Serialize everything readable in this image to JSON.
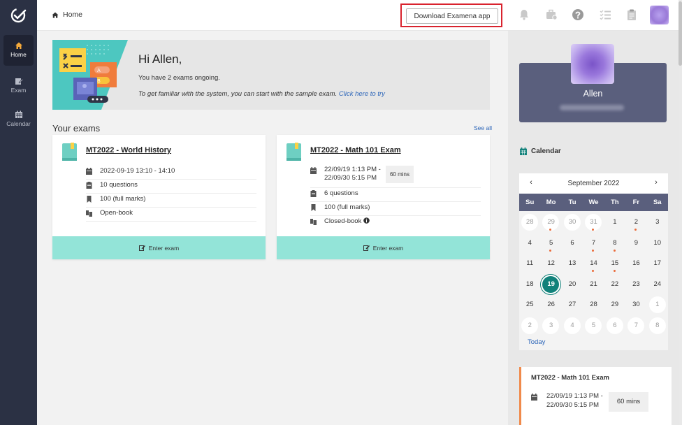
{
  "sidebar": {
    "items": [
      {
        "label": "Home",
        "icon": "home-icon",
        "active": true
      },
      {
        "label": "Exam",
        "icon": "exam-icon",
        "active": false
      },
      {
        "label": "Calendar",
        "icon": "calendar-icon",
        "active": false
      }
    ]
  },
  "header": {
    "breadcrumb": "Home",
    "download_label": "Download Examena app",
    "icons": [
      "bell-icon",
      "briefcase-icon",
      "help-icon",
      "checklist-icon",
      "clipboard-icon"
    ]
  },
  "welcome": {
    "greeting": "Hi Allen,",
    "ongoing": "You have 2 exams ongoing.",
    "familiar_text": "To get familiar with the system, you can start with the sample exam.",
    "familiar_link": "Click here to try"
  },
  "exams_section": {
    "title": "Your exams",
    "see_all": "See all"
  },
  "exams": [
    {
      "title": "MT2022 - World History",
      "datetime": "2022-09-19 13:10 - 14:10",
      "questions": "10 questions",
      "marks": "100 (full marks)",
      "mode": "Open-book",
      "enter_label": "Enter exam"
    },
    {
      "title": "MT2022 - Math 101 Exam",
      "datetime_line1": "22/09/19 1:13 PM -",
      "datetime_line2": "22/09/30 5:15 PM",
      "duration": "60 mins",
      "questions": "6 questions",
      "marks": "100 (full marks)",
      "mode": "Closed-book",
      "enter_label": "Enter exam"
    }
  ],
  "profile": {
    "name": "Allen"
  },
  "calendar": {
    "heading": "Calendar",
    "month": "September 2022",
    "prev": "‹",
    "next": "›",
    "weekdays": [
      "Su",
      "Mo",
      "Tu",
      "We",
      "Th",
      "Fr",
      "Sa"
    ],
    "today_label": "Today",
    "days": [
      {
        "n": "28",
        "other": true
      },
      {
        "n": "29",
        "other": true,
        "dot": true
      },
      {
        "n": "30",
        "other": true
      },
      {
        "n": "31",
        "other": true,
        "dot": true
      },
      {
        "n": "1"
      },
      {
        "n": "2",
        "dot": true
      },
      {
        "n": "3"
      },
      {
        "n": "4"
      },
      {
        "n": "5",
        "dot": true
      },
      {
        "n": "6"
      },
      {
        "n": "7",
        "dot": true
      },
      {
        "n": "8",
        "dot": true
      },
      {
        "n": "9"
      },
      {
        "n": "10"
      },
      {
        "n": "11"
      },
      {
        "n": "12"
      },
      {
        "n": "13"
      },
      {
        "n": "14",
        "dot": true
      },
      {
        "n": "15",
        "dot": true
      },
      {
        "n": "16"
      },
      {
        "n": "17"
      },
      {
        "n": "18"
      },
      {
        "n": "19",
        "today": true
      },
      {
        "n": "20"
      },
      {
        "n": "21"
      },
      {
        "n": "22"
      },
      {
        "n": "23"
      },
      {
        "n": "24"
      },
      {
        "n": "25"
      },
      {
        "n": "26"
      },
      {
        "n": "27"
      },
      {
        "n": "28"
      },
      {
        "n": "29"
      },
      {
        "n": "30"
      },
      {
        "n": "1",
        "other": true
      },
      {
        "n": "2",
        "other": true
      },
      {
        "n": "3",
        "other": true
      },
      {
        "n": "4",
        "other": true
      },
      {
        "n": "5",
        "other": true
      },
      {
        "n": "6",
        "other": true
      },
      {
        "n": "7",
        "other": true
      },
      {
        "n": "8",
        "other": true
      }
    ]
  },
  "event": {
    "title": "MT2022 - Math 101 Exam",
    "time_line1": "22/09/19 1:13 PM -",
    "time_line2": "22/09/30 5:15 PM",
    "duration": "60 mins"
  },
  "colors": {
    "sidebar": "#2b3144",
    "accent_orange": "#f4a93b",
    "teal_button": "#93e4d8",
    "today": "#11817a",
    "event_border": "#f08a4b",
    "link": "#2a64b8",
    "highlight_border": "#d9232e"
  }
}
